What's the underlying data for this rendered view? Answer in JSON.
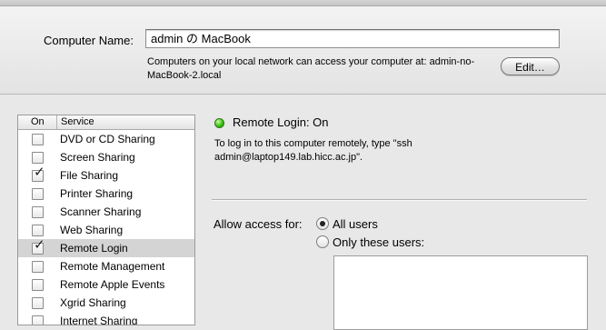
{
  "computer_name": {
    "label": "Computer Name:",
    "value": "admin の MacBook",
    "info": "Computers on your local network can access your computer at: admin-no-MacBook-2.local",
    "edit_label": "Edit…"
  },
  "services": {
    "col_on": "On",
    "col_service": "Service",
    "items": [
      {
        "label": "DVD or CD Sharing",
        "on": false
      },
      {
        "label": "Screen Sharing",
        "on": false
      },
      {
        "label": "File Sharing",
        "on": true
      },
      {
        "label": "Printer Sharing",
        "on": false
      },
      {
        "label": "Scanner Sharing",
        "on": false
      },
      {
        "label": "Web Sharing",
        "on": false
      },
      {
        "label": "Remote Login",
        "on": true,
        "selected": true
      },
      {
        "label": "Remote Management",
        "on": false
      },
      {
        "label": "Remote Apple Events",
        "on": false
      },
      {
        "label": "Xgrid Sharing",
        "on": false
      },
      {
        "label": "Internet Sharing",
        "on": false
      }
    ]
  },
  "detail": {
    "status": "Remote Login: On",
    "status_color": "#3ec11a",
    "description": "To log in to this computer remotely, type \"ssh admin@laptop149.lab.hicc.ac.jp\".",
    "allow_label": "Allow access for:",
    "options": {
      "all_users": "All users",
      "only_these_users": "Only these users:",
      "selected": "all_users"
    }
  }
}
